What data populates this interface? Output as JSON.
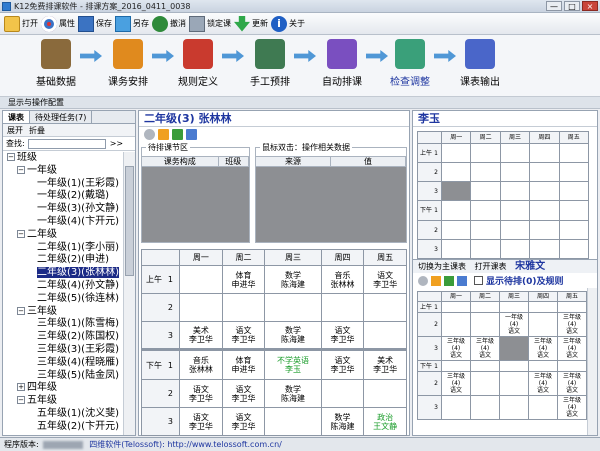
{
  "window": {
    "title": "K12免费排课软件 - 排课方案_2016_0411_0038",
    "min": "—",
    "max": "□",
    "close": "×"
  },
  "toolbar": [
    {
      "label": "打开",
      "icon": "folder-open-icon"
    },
    {
      "label": "属性",
      "icon": "properties-icon"
    },
    {
      "label": "保存",
      "icon": "save-icon"
    },
    {
      "label": "另存",
      "icon": "save-as-icon"
    },
    {
      "label": "撤消",
      "icon": "undo-icon"
    },
    {
      "label": "锁定课",
      "icon": "lock-icon"
    },
    {
      "label": "更新",
      "icon": "update-icon"
    },
    {
      "label": "关于",
      "icon": "about-icon"
    }
  ],
  "workflow": [
    {
      "label": "基础数据",
      "color": "#8a6a3c"
    },
    {
      "label": "课务安排",
      "color": "#e08a1e"
    },
    {
      "label": "规则定义",
      "color": "#c93a2e"
    },
    {
      "label": "手工预排",
      "color": "#3f7a52"
    },
    {
      "label": "自动排课",
      "color": "#7a4fc0"
    },
    {
      "label": "检查调整",
      "color": "#3aa07a"
    },
    {
      "label": "课表输出",
      "color": "#4a66c9"
    }
  ],
  "panel_title": "显示与操作配置",
  "left": {
    "tabs": [
      "课表",
      "待处理任务(7)"
    ],
    "controls": [
      "展开",
      "折叠"
    ],
    "search_label": "查找:",
    "search_go": ">>",
    "tree": [
      {
        "text": "班级",
        "level": 0,
        "exp": "-"
      },
      {
        "text": "一年级",
        "level": 1,
        "exp": "-"
      },
      {
        "text": "一年级(1)(王彩霞)",
        "level": 2
      },
      {
        "text": "一年级(2)(戴璐)",
        "level": 2
      },
      {
        "text": "一年级(3)(孙文静)",
        "level": 2
      },
      {
        "text": "一年级(4)(卞开元)",
        "level": 2
      },
      {
        "text": "二年级",
        "level": 1,
        "exp": "-"
      },
      {
        "text": "二年级(1)(李小丽)",
        "level": 2
      },
      {
        "text": "二年级(2)(申进)",
        "level": 2
      },
      {
        "text": "二年级(3)(张林林)",
        "level": 2,
        "selected": true
      },
      {
        "text": "二年级(4)(孙文静)",
        "level": 2
      },
      {
        "text": "二年级(5)(徐连林)",
        "level": 2
      },
      {
        "text": "三年级",
        "level": 1,
        "exp": "-"
      },
      {
        "text": "三年级(1)(陈雪梅)",
        "level": 2
      },
      {
        "text": "三年级(2)(陈国权)",
        "level": 2
      },
      {
        "text": "三年级(3)(王彩霞)",
        "level": 2
      },
      {
        "text": "三年级(4)(程晓雁)",
        "level": 2
      },
      {
        "text": "三年级(5)(陆金凤)",
        "level": 2
      },
      {
        "text": "四年级",
        "level": 1,
        "exp": "+"
      },
      {
        "text": "五年级",
        "level": 1,
        "exp": "-"
      },
      {
        "text": "五年级(1)(沈义斐)",
        "level": 2
      },
      {
        "text": "五年级(2)(卞开元)",
        "level": 2
      }
    ]
  },
  "mid": {
    "class_title": "二年级(3) 张林林",
    "pending": {
      "legend": "待排课节区",
      "cols": [
        "课务构成",
        "班级"
      ]
    },
    "mouse": {
      "legend": "鼠标双击：操作相关数据",
      "cols": [
        "来源",
        "值"
      ]
    },
    "days": [
      "周一",
      "周二",
      "周三",
      "周四",
      "周五"
    ],
    "periods": [
      {
        "group": "上午",
        "num": "1",
        "cells": [
          "",
          "体育\n申进华",
          "数学\n陈海建",
          "音乐\n张林林",
          "语文\n李卫华"
        ]
      },
      {
        "group": "",
        "num": "2",
        "cells": [
          "",
          "",
          "",
          "",
          ""
        ]
      },
      {
        "group": "",
        "num": "3",
        "cells": [
          "美术\n李卫华",
          "语文\n李卫华",
          "数学\n陈海建",
          "语文\n李卫华",
          ""
        ]
      },
      {
        "group": "下午",
        "num": "1",
        "cells": [
          "音乐\n张林林",
          "体育\n申进华",
          "不学英语\n李玉",
          "语文\n李卫华",
          "美术\n李卫华"
        ]
      },
      {
        "group": "",
        "num": "2",
        "cells": [
          "语文\n李卫华",
          "语文\n李卫华",
          "数学\n陈海建",
          "",
          ""
        ]
      },
      {
        "group": "",
        "num": "3",
        "cells": [
          "语文\n李卫华",
          "语文\n李卫华",
          "",
          "数学\n陈海建",
          "政治\n王文静"
        ]
      }
    ]
  },
  "right": {
    "teacher_title": "李玉",
    "days": [
      "周一",
      "周二",
      "周三",
      "周四",
      "周五"
    ],
    "switch_label": "切换为主课表",
    "open_label": "打开课表",
    "teacher2": "宋雅文",
    "show_label": "显示待排(0)及规则",
    "grid2_rows": [
      {
        "group": "上午",
        "num": "1",
        "cells": [
          "",
          "",
          "",
          "",
          ""
        ]
      },
      {
        "group": "",
        "num": "2",
        "cells": [
          "",
          "",
          "一年级\n(4)\n语文",
          "",
          "三年级\n(4)\n语文"
        ]
      },
      {
        "group": "",
        "num": "3",
        "cells": [
          "三年级\n(4)\n语文",
          "三年级\n(4)\n语文",
          "",
          "三年级\n(4)\n语文",
          "三年级\n(4)\n语文"
        ]
      },
      {
        "group": "下午",
        "num": "1",
        "cells": [
          "",
          "",
          "",
          "",
          ""
        ]
      },
      {
        "group": "",
        "num": "2",
        "cells": [
          "三年级\n(4)\n语文",
          "",
          "",
          "三年级\n(4)\n语文",
          "三年级\n(4)\n语文"
        ]
      },
      {
        "group": "",
        "num": "3",
        "cells": [
          "",
          "",
          "",
          "",
          "三年级\n(4)\n语文"
        ]
      }
    ]
  },
  "status": {
    "version_label": "程序版本:",
    "company": "四维软件(Telossoft): http://www.telossoft.com.cn/"
  }
}
